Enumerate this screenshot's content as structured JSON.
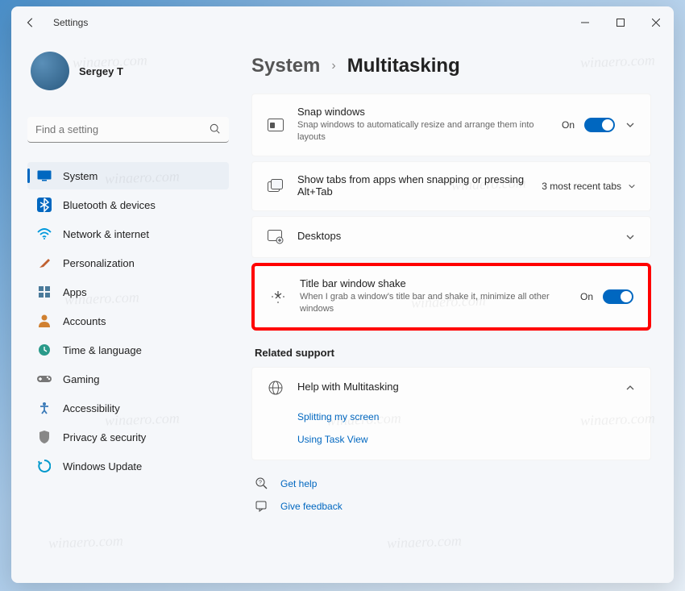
{
  "window": {
    "title": "Settings"
  },
  "profile": {
    "name": "Sergey T"
  },
  "search": {
    "placeholder": "Find a setting"
  },
  "nav": [
    {
      "label": "System",
      "icon": "display",
      "color": "#0067c0",
      "active": true
    },
    {
      "label": "Bluetooth & devices",
      "icon": "bluetooth",
      "color": "#0067c0"
    },
    {
      "label": "Network & internet",
      "icon": "wifi",
      "color": "#0099dd"
    },
    {
      "label": "Personalization",
      "icon": "brush",
      "color": "#c06030"
    },
    {
      "label": "Apps",
      "icon": "apps",
      "color": "#4a7a9a"
    },
    {
      "label": "Accounts",
      "icon": "person",
      "color": "#d08030"
    },
    {
      "label": "Time & language",
      "icon": "clock",
      "color": "#2a9a8a"
    },
    {
      "label": "Gaming",
      "icon": "gamepad",
      "color": "#777"
    },
    {
      "label": "Accessibility",
      "icon": "accessibility",
      "color": "#3a7ab8"
    },
    {
      "label": "Privacy & security",
      "icon": "shield",
      "color": "#888"
    },
    {
      "label": "Windows Update",
      "icon": "update",
      "color": "#0099cc"
    }
  ],
  "breadcrumb": {
    "parent": "System",
    "current": "Multitasking"
  },
  "cards": {
    "snap": {
      "title": "Snap windows",
      "desc": "Snap windows to automatically resize and arrange them into layouts",
      "state": "On"
    },
    "tabs": {
      "title": "Show tabs from apps when snapping or pressing Alt+Tab",
      "value": "3 most recent tabs"
    },
    "desktops": {
      "title": "Desktops"
    },
    "shake": {
      "title": "Title bar window shake",
      "desc": "When I grab a window's title bar and shake it, minimize all other windows",
      "state": "On"
    }
  },
  "related": {
    "header": "Related support",
    "help_title": "Help with Multitasking",
    "links": [
      "Splitting my screen",
      "Using Task View"
    ]
  },
  "footer": {
    "get_help": "Get help",
    "feedback": "Give feedback"
  },
  "watermark": "winaero.com"
}
